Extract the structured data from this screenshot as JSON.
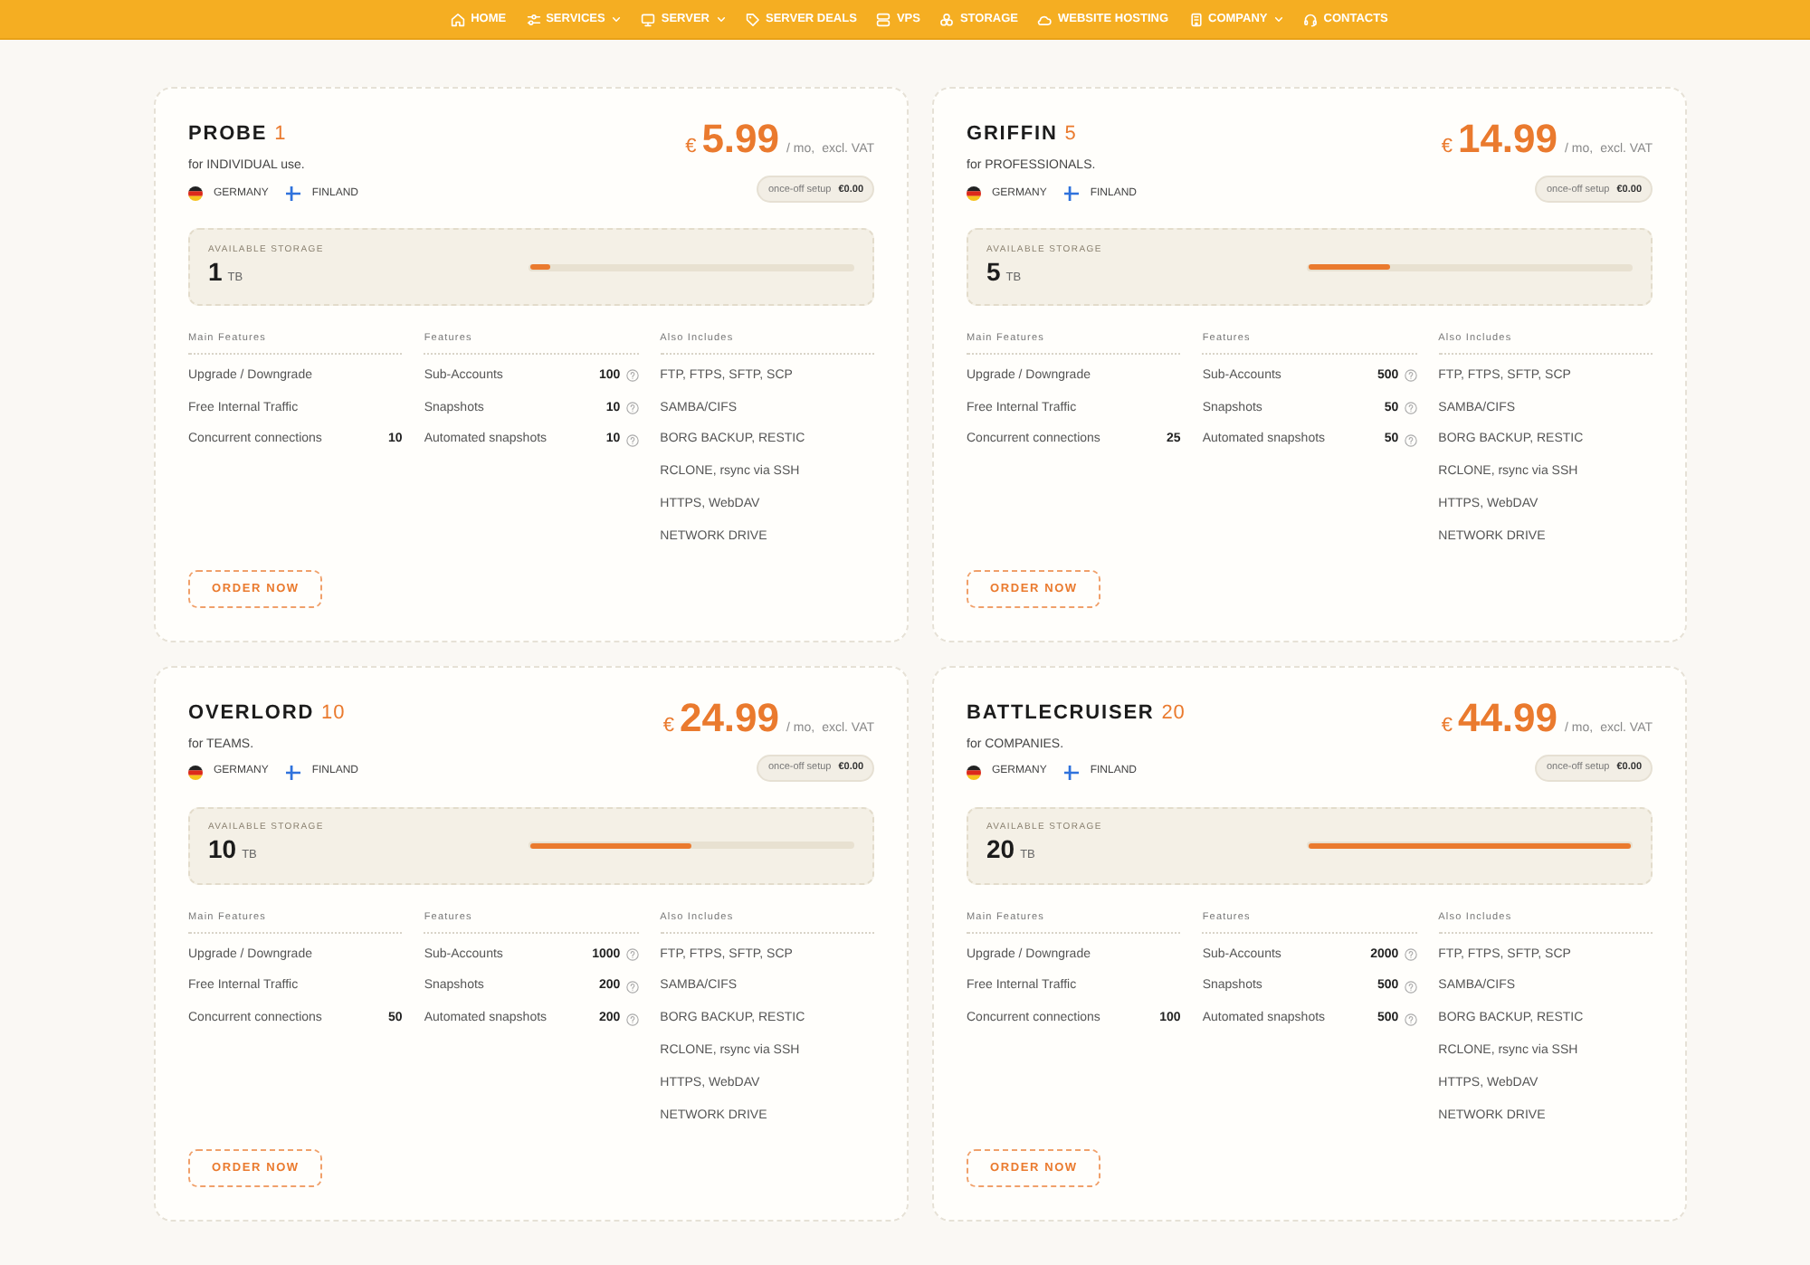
{
  "nav": {
    "items": [
      {
        "label": "HOME",
        "dropdown": false
      },
      {
        "label": "SERVICES",
        "dropdown": true
      },
      {
        "label": "SERVER",
        "dropdown": true
      },
      {
        "label": "SERVER DEALS",
        "dropdown": false
      },
      {
        "label": "VPS",
        "dropdown": false
      },
      {
        "label": "STORAGE",
        "dropdown": false
      },
      {
        "label": "WEBSITE HOSTING",
        "dropdown": false
      },
      {
        "label": "COMPANY",
        "dropdown": true
      },
      {
        "label": "CONTACTS",
        "dropdown": false
      }
    ]
  },
  "plans": [
    {
      "name": "PROBE",
      "tier": "1",
      "audience": "for INDIVIDUAL use.",
      "price": {
        "currency": "€",
        "amount": "5.99",
        "period": "/ mo,",
        "note": "excl. VAT"
      },
      "setup": {
        "label": "once-off setup",
        "price": "€0.00"
      },
      "locations": [
        "GERMANY",
        "FINLAND"
      ],
      "storage": {
        "label": "AVAILABLE STORAGE",
        "amount": "1",
        "unit": "TB",
        "level": 0.06
      },
      "main_features": {
        "heading": "Main Features",
        "items": [
          {
            "label": "Upgrade / Downgrade"
          },
          {
            "label": "Free Internal Traffic"
          },
          {
            "label": "Concurrent connections",
            "value": "10"
          }
        ]
      },
      "features": {
        "heading": "Features",
        "items": [
          {
            "label": "Sub-Accounts",
            "value": "100"
          },
          {
            "label": "Snapshots",
            "value": "10"
          },
          {
            "label": "Automated snapshots",
            "value": "10"
          }
        ]
      },
      "also_includes": {
        "heading": "Also Includes",
        "items": [
          "FTP, FTPS, SFTP, SCP",
          "SAMBA/CIFS",
          "BORG BACKUP, RESTIC",
          "RCLONE, rsync via SSH",
          "HTTPS, WebDAV",
          "NETWORK DRIVE"
        ]
      },
      "order_button": "ORDER NOW"
    },
    {
      "name": "GRIFFIN",
      "tier": "5",
      "audience": "for PROFESSIONALS.",
      "price": {
        "currency": "€",
        "amount": "14.99",
        "period": "/ mo,",
        "note": "excl. VAT"
      },
      "setup": {
        "label": "once-off setup",
        "price": "€0.00"
      },
      "locations": [
        "GERMANY",
        "FINLAND"
      ],
      "storage": {
        "label": "AVAILABLE STORAGE",
        "amount": "5",
        "unit": "TB",
        "level": 0.25
      },
      "main_features": {
        "heading": "Main Features",
        "items": [
          {
            "label": "Upgrade / Downgrade"
          },
          {
            "label": "Free Internal Traffic"
          },
          {
            "label": "Concurrent connections",
            "value": "25"
          }
        ]
      },
      "features": {
        "heading": "Features",
        "items": [
          {
            "label": "Sub-Accounts",
            "value": "500"
          },
          {
            "label": "Snapshots",
            "value": "50"
          },
          {
            "label": "Automated snapshots",
            "value": "50"
          }
        ]
      },
      "also_includes": {
        "heading": "Also Includes",
        "items": [
          "FTP, FTPS, SFTP, SCP",
          "SAMBA/CIFS",
          "BORG BACKUP, RESTIC",
          "RCLONE, rsync via SSH",
          "HTTPS, WebDAV",
          "NETWORK DRIVE"
        ]
      },
      "order_button": "ORDER NOW"
    },
    {
      "name": "OVERLORD",
      "tier": "10",
      "audience": "for TEAMS.",
      "price": {
        "currency": "€",
        "amount": "24.99",
        "period": "/ mo,",
        "note": "excl. VAT"
      },
      "setup": {
        "label": "once-off setup",
        "price": "€0.00"
      },
      "locations": [
        "GERMANY",
        "FINLAND"
      ],
      "storage": {
        "label": "AVAILABLE STORAGE",
        "amount": "10",
        "unit": "TB",
        "level": 0.5
      },
      "main_features": {
        "heading": "Main Features",
        "items": [
          {
            "label": "Upgrade / Downgrade"
          },
          {
            "label": "Free Internal Traffic"
          },
          {
            "label": "Concurrent connections",
            "value": "50"
          }
        ]
      },
      "features": {
        "heading": "Features",
        "items": [
          {
            "label": "Sub-Accounts",
            "value": "1000"
          },
          {
            "label": "Snapshots",
            "value": "200"
          },
          {
            "label": "Automated snapshots",
            "value": "200"
          }
        ]
      },
      "also_includes": {
        "heading": "Also Includes",
        "items": [
          "FTP, FTPS, SFTP, SCP",
          "SAMBA/CIFS",
          "BORG BACKUP, RESTIC",
          "RCLONE, rsync via SSH",
          "HTTPS, WebDAV",
          "NETWORK DRIVE"
        ]
      },
      "order_button": "ORDER NOW"
    },
    {
      "name": "BATTLECRUISER",
      "tier": "20",
      "audience": "for COMPANIES.",
      "price": {
        "currency": "€",
        "amount": "44.99",
        "period": "/ mo,",
        "note": "excl. VAT"
      },
      "setup": {
        "label": "once-off setup",
        "price": "€0.00"
      },
      "locations": [
        "GERMANY",
        "FINLAND"
      ],
      "storage": {
        "label": "AVAILABLE STORAGE",
        "amount": "20",
        "unit": "TB",
        "level": 1.0
      },
      "main_features": {
        "heading": "Main Features",
        "items": [
          {
            "label": "Upgrade / Downgrade"
          },
          {
            "label": "Free Internal Traffic"
          },
          {
            "label": "Concurrent connections",
            "value": "100"
          }
        ]
      },
      "features": {
        "heading": "Features",
        "items": [
          {
            "label": "Sub-Accounts",
            "value": "2000"
          },
          {
            "label": "Snapshots",
            "value": "500"
          },
          {
            "label": "Automated snapshots",
            "value": "500"
          }
        ]
      },
      "also_includes": {
        "heading": "Also Includes",
        "items": [
          "FTP, FTPS, SFTP, SCP",
          "SAMBA/CIFS",
          "BORG BACKUP, RESTIC",
          "RCLONE, rsync via SSH",
          "HTTPS, WebDAV",
          "NETWORK DRIVE"
        ]
      },
      "order_button": "ORDER NOW"
    }
  ]
}
